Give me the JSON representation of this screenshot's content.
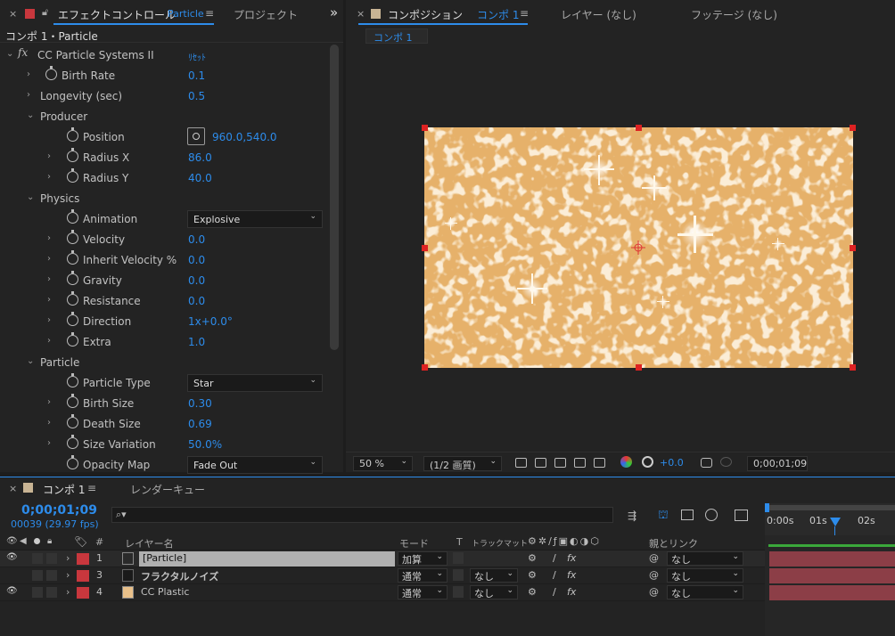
{
  "effects_panel": {
    "close": "×",
    "title": "エフェクトコントロール",
    "layer": "Particle",
    "menu": "≡",
    "tab2": "プロジェクト",
    "expand": "»",
    "breadcrumb": "コンポ 1・Particle",
    "effect_name": "CC Particle Systems II",
    "reset": "ﾘｾｯﾄ",
    "fx": "fx",
    "rows": [
      {
        "label": "Birth Rate",
        "value": "0.1"
      },
      {
        "label": "Longevity (sec)",
        "value": "0.5"
      },
      {
        "label": "Producer",
        "value": ""
      },
      {
        "label": "Position",
        "value": "960.0,540.0"
      },
      {
        "label": "Radius X",
        "value": "86.0"
      },
      {
        "label": "Radius Y",
        "value": "40.0"
      },
      {
        "label": "Physics",
        "value": ""
      },
      {
        "label": "Animation",
        "value": "Explosive"
      },
      {
        "label": "Velocity",
        "value": "0.0"
      },
      {
        "label": "Inherit Velocity %",
        "value": "0.0"
      },
      {
        "label": "Gravity",
        "value": "0.0"
      },
      {
        "label": "Resistance",
        "value": "0.0"
      },
      {
        "label": "Direction",
        "value": "1x+0.0°"
      },
      {
        "label": "Extra",
        "value": "1.0"
      },
      {
        "label": "Particle",
        "value": ""
      },
      {
        "label": "Particle Type",
        "value": "Star"
      },
      {
        "label": "Birth Size",
        "value": "0.30"
      },
      {
        "label": "Death Size",
        "value": "0.69"
      },
      {
        "label": "Size Variation",
        "value": "50.0%"
      },
      {
        "label": "Opacity Map",
        "value": "Fade Out"
      }
    ]
  },
  "comp_panel": {
    "close": "×",
    "title": "コンポジション",
    "comp": "コンポ 1",
    "menu": "≡",
    "tab_layer": "レイヤー (なし)",
    "tab_footage": "フッテージ (なし)",
    "comp_chip": "コンポ 1",
    "zoom": "50 %",
    "resolution": "(1/2 画質)",
    "exposure": "+0.0",
    "timecode": "0;00;01;09"
  },
  "timeline": {
    "close": "×",
    "tab": "コンポ 1",
    "menu": "≡",
    "render_queue": "レンダーキュー",
    "timecode": "0;00;01;09",
    "frames": "00039 (29.97 fps)",
    "search_icon": "⌕▾",
    "headers": {
      "num": "#",
      "name": "レイヤー名",
      "mode": "モード",
      "t": "T",
      "track": "トラックマット",
      "parent": "親とリンク"
    },
    "ruler": [
      "0:00s",
      "01s",
      "02s"
    ],
    "layers": [
      {
        "num": "1",
        "name": "[Particle]",
        "mode": "加算",
        "track": "",
        "parent": "なし",
        "color": "#000000",
        "fx": "fx"
      },
      {
        "num": "3",
        "name": "フラクタルノイズ",
        "mode": "通常",
        "track": "なし",
        "parent": "なし",
        "color": "#1a1a1a",
        "fx": "fx"
      },
      {
        "num": "4",
        "name": "CC Plastic",
        "mode": "通常",
        "track": "なし",
        "parent": "なし",
        "color": "#e8c08a",
        "fx": "fx"
      }
    ]
  },
  "colors": {
    "accent": "#2d8ceb",
    "label_red": "#c8373d",
    "canvas": "#e8b46a",
    "bar": "#8c3e47"
  }
}
